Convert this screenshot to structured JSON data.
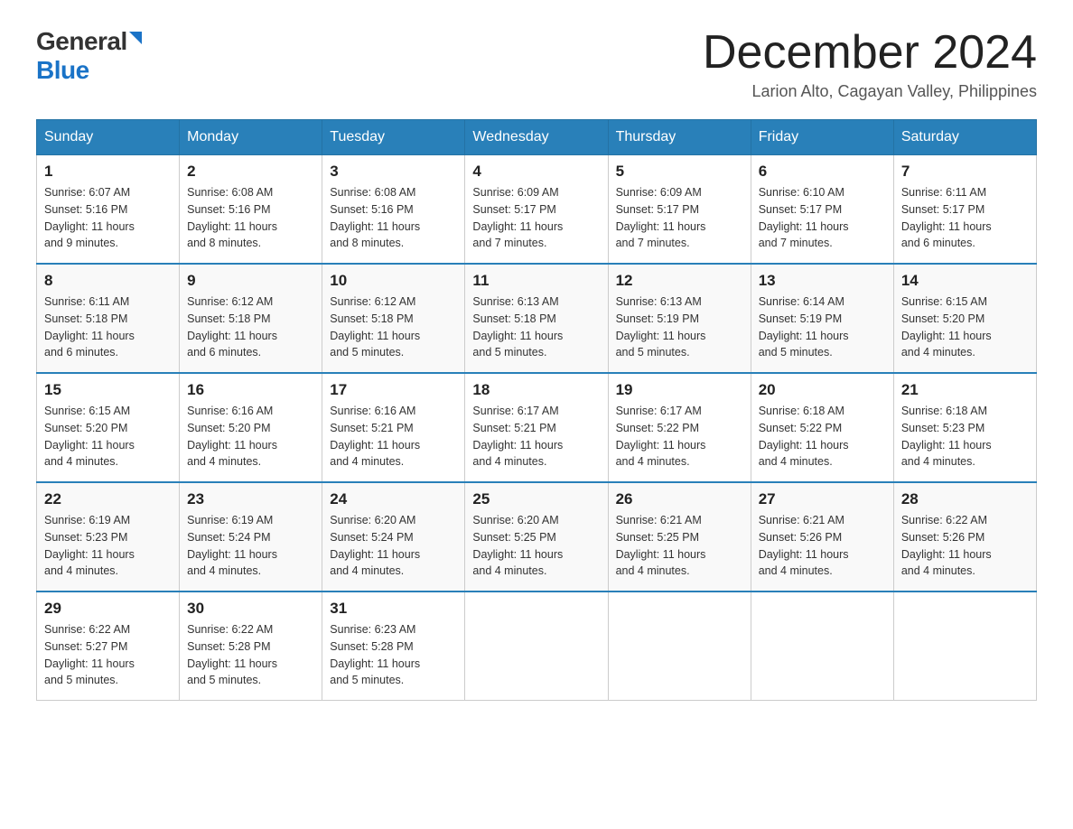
{
  "header": {
    "logo_general": "General",
    "logo_blue": "Blue",
    "month_title": "December 2024",
    "location": "Larion Alto, Cagayan Valley, Philippines"
  },
  "days_of_week": [
    "Sunday",
    "Monday",
    "Tuesday",
    "Wednesday",
    "Thursday",
    "Friday",
    "Saturday"
  ],
  "weeks": [
    [
      {
        "date": "1",
        "sunrise": "6:07 AM",
        "sunset": "5:16 PM",
        "daylight": "11 hours and 9 minutes."
      },
      {
        "date": "2",
        "sunrise": "6:08 AM",
        "sunset": "5:16 PM",
        "daylight": "11 hours and 8 minutes."
      },
      {
        "date": "3",
        "sunrise": "6:08 AM",
        "sunset": "5:16 PM",
        "daylight": "11 hours and 8 minutes."
      },
      {
        "date": "4",
        "sunrise": "6:09 AM",
        "sunset": "5:17 PM",
        "daylight": "11 hours and 7 minutes."
      },
      {
        "date": "5",
        "sunrise": "6:09 AM",
        "sunset": "5:17 PM",
        "daylight": "11 hours and 7 minutes."
      },
      {
        "date": "6",
        "sunrise": "6:10 AM",
        "sunset": "5:17 PM",
        "daylight": "11 hours and 7 minutes."
      },
      {
        "date": "7",
        "sunrise": "6:11 AM",
        "sunset": "5:17 PM",
        "daylight": "11 hours and 6 minutes."
      }
    ],
    [
      {
        "date": "8",
        "sunrise": "6:11 AM",
        "sunset": "5:18 PM",
        "daylight": "11 hours and 6 minutes."
      },
      {
        "date": "9",
        "sunrise": "6:12 AM",
        "sunset": "5:18 PM",
        "daylight": "11 hours and 6 minutes."
      },
      {
        "date": "10",
        "sunrise": "6:12 AM",
        "sunset": "5:18 PM",
        "daylight": "11 hours and 5 minutes."
      },
      {
        "date": "11",
        "sunrise": "6:13 AM",
        "sunset": "5:18 PM",
        "daylight": "11 hours and 5 minutes."
      },
      {
        "date": "12",
        "sunrise": "6:13 AM",
        "sunset": "5:19 PM",
        "daylight": "11 hours and 5 minutes."
      },
      {
        "date": "13",
        "sunrise": "6:14 AM",
        "sunset": "5:19 PM",
        "daylight": "11 hours and 5 minutes."
      },
      {
        "date": "14",
        "sunrise": "6:15 AM",
        "sunset": "5:20 PM",
        "daylight": "11 hours and 4 minutes."
      }
    ],
    [
      {
        "date": "15",
        "sunrise": "6:15 AM",
        "sunset": "5:20 PM",
        "daylight": "11 hours and 4 minutes."
      },
      {
        "date": "16",
        "sunrise": "6:16 AM",
        "sunset": "5:20 PM",
        "daylight": "11 hours and 4 minutes."
      },
      {
        "date": "17",
        "sunrise": "6:16 AM",
        "sunset": "5:21 PM",
        "daylight": "11 hours and 4 minutes."
      },
      {
        "date": "18",
        "sunrise": "6:17 AM",
        "sunset": "5:21 PM",
        "daylight": "11 hours and 4 minutes."
      },
      {
        "date": "19",
        "sunrise": "6:17 AM",
        "sunset": "5:22 PM",
        "daylight": "11 hours and 4 minutes."
      },
      {
        "date": "20",
        "sunrise": "6:18 AM",
        "sunset": "5:22 PM",
        "daylight": "11 hours and 4 minutes."
      },
      {
        "date": "21",
        "sunrise": "6:18 AM",
        "sunset": "5:23 PM",
        "daylight": "11 hours and 4 minutes."
      }
    ],
    [
      {
        "date": "22",
        "sunrise": "6:19 AM",
        "sunset": "5:23 PM",
        "daylight": "11 hours and 4 minutes."
      },
      {
        "date": "23",
        "sunrise": "6:19 AM",
        "sunset": "5:24 PM",
        "daylight": "11 hours and 4 minutes."
      },
      {
        "date": "24",
        "sunrise": "6:20 AM",
        "sunset": "5:24 PM",
        "daylight": "11 hours and 4 minutes."
      },
      {
        "date": "25",
        "sunrise": "6:20 AM",
        "sunset": "5:25 PM",
        "daylight": "11 hours and 4 minutes."
      },
      {
        "date": "26",
        "sunrise": "6:21 AM",
        "sunset": "5:25 PM",
        "daylight": "11 hours and 4 minutes."
      },
      {
        "date": "27",
        "sunrise": "6:21 AM",
        "sunset": "5:26 PM",
        "daylight": "11 hours and 4 minutes."
      },
      {
        "date": "28",
        "sunrise": "6:22 AM",
        "sunset": "5:26 PM",
        "daylight": "11 hours and 4 minutes."
      }
    ],
    [
      {
        "date": "29",
        "sunrise": "6:22 AM",
        "sunset": "5:27 PM",
        "daylight": "11 hours and 5 minutes."
      },
      {
        "date": "30",
        "sunrise": "6:22 AM",
        "sunset": "5:28 PM",
        "daylight": "11 hours and 5 minutes."
      },
      {
        "date": "31",
        "sunrise": "6:23 AM",
        "sunset": "5:28 PM",
        "daylight": "11 hours and 5 minutes."
      },
      null,
      null,
      null,
      null
    ]
  ],
  "labels": {
    "sunrise": "Sunrise:",
    "sunset": "Sunset:",
    "daylight": "Daylight:"
  }
}
